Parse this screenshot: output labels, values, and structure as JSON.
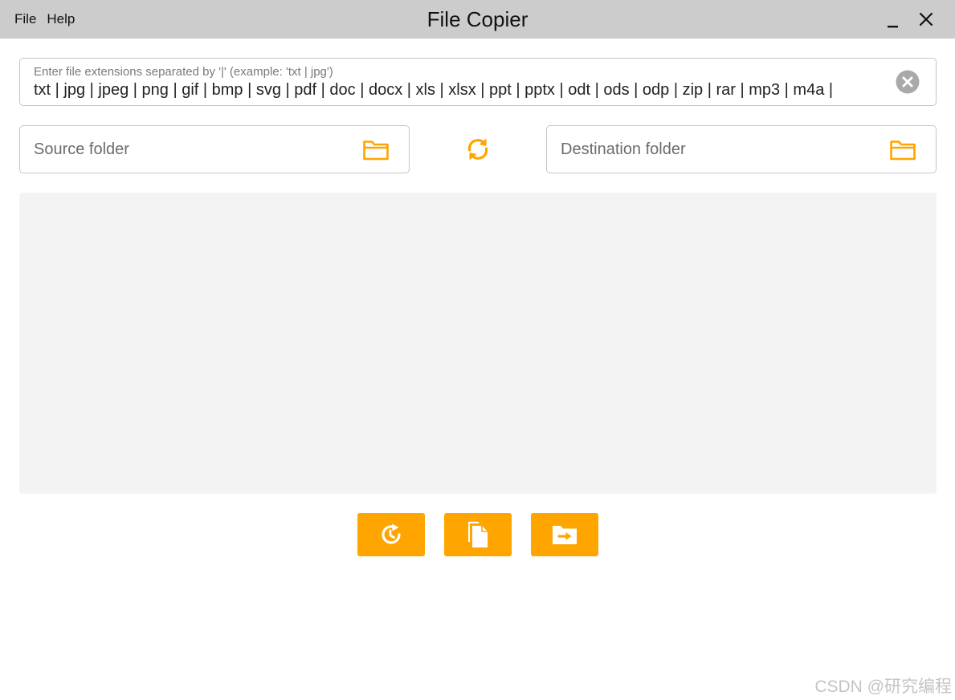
{
  "menu": {
    "file_label": "File",
    "help_label": "Help"
  },
  "window": {
    "title": "File Copier"
  },
  "extensions": {
    "label": "Enter file extensions separated by '|' (example: 'txt | jpg')",
    "value": "txt | jpg | jpeg | png | gif | bmp | svg | pdf | doc | docx | xls | xlsx | ppt | pptx | odt | ods | odp | zip | rar | mp3 | m4a |"
  },
  "source": {
    "placeholder": "Source folder"
  },
  "destination": {
    "placeholder": "Destination folder"
  },
  "icons": {
    "minimize": "minimize-icon",
    "close": "close-icon",
    "clear": "clear-circle-icon",
    "folder": "folder-icon",
    "swap": "swap-refresh-icon",
    "history": "history-icon",
    "copy": "copy-files-icon",
    "move": "move-folder-icon"
  },
  "colors": {
    "accent": "#FFA500",
    "titlebar": "#CCCCCC",
    "list_background": "#F3F3F3"
  },
  "watermark": "CSDN @研究编程"
}
